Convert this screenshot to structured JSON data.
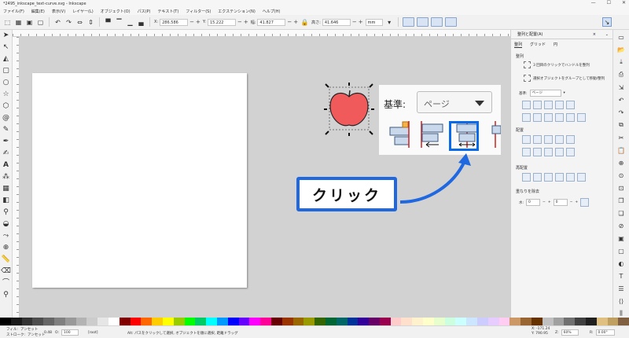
{
  "window": {
    "title": "*2495_inkscape_text-curve.svg - Inkscape",
    "controls": [
      "—",
      "☐",
      "✕"
    ]
  },
  "menubar": [
    "ファイル(F)",
    "編集(E)",
    "表示(V)",
    "レイヤー(L)",
    "オブジェクト(O)",
    "パス(P)",
    "テキスト(T)",
    "フィルター(S)",
    "エクステンション(N)",
    "ヘルプ(H)"
  ],
  "toolbar": {
    "x_label": "X:",
    "x_value": "286.586",
    "y_label": "Y:",
    "y_value": "15.222",
    "w_label": "幅:",
    "w_value": "41.827",
    "h_label": "高さ:",
    "h_value": "41.646",
    "unit": "mm"
  },
  "popup": {
    "label": "基準:",
    "select_value": "ページ"
  },
  "callout": {
    "text": "クリック"
  },
  "panel": {
    "title": "整列と配置(A)",
    "tabs": [
      "整列",
      "グリッド",
      "円"
    ],
    "section_align": "整列",
    "option1": "3 回目のクリックでハンドルを整列",
    "option2": "選択オブジェクトをグループとして移動/整列",
    "relative_label": "基準:",
    "relative_value": "ページ",
    "section_distribute": "配置",
    "section_rearrange": "再配置",
    "section_overlap": "重なりを除去",
    "h_gap_label": "水:",
    "h_gap_value": "0",
    "v_gap_value": "0"
  },
  "status": {
    "fill_label": "フィル:",
    "fill_value": "アンセット",
    "stroke_label": "ストローク:",
    "stroke_value": "アンセット",
    "stroke_width": "0.48",
    "opacity_label": "O:",
    "opacity_value": "100",
    "layer": "[root]",
    "message": "Alt: パスをクリックして選択, オブジェクトを順に選択, 距離ドラッグ",
    "x_coord": "X: -171.24",
    "y_coord": "Y: 790.95",
    "zoom_label": "Z:",
    "zoom_value": "60%",
    "rotation_label": "R:",
    "rotation_value": "0.00°"
  },
  "colors": {
    "accent": "#1f68e0",
    "apple_red": "#f05a5a",
    "canvas": "#d2d2d2"
  },
  "icons": {
    "apple": "apple-icon",
    "arrow": "curved-arrow-icon"
  }
}
